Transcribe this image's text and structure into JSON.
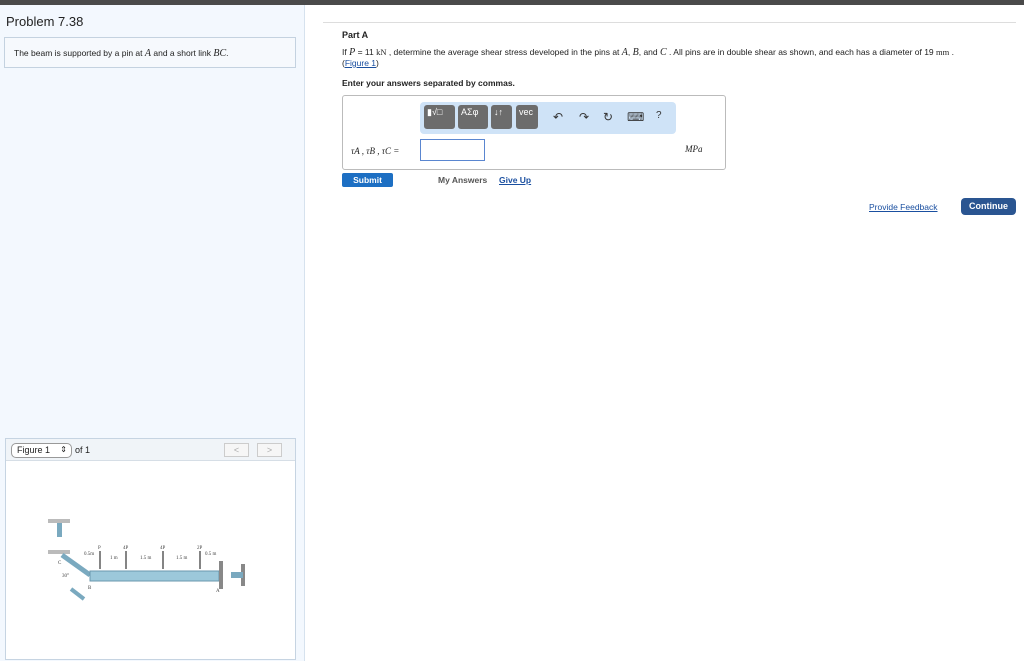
{
  "problem": {
    "title": "Problem 7.38",
    "intro_pre": "The beam is supported by a pin at ",
    "intro_A": "A",
    "intro_mid": " and a short link ",
    "intro_BC": "BC",
    "intro_end": "."
  },
  "figure": {
    "select_value": "Figure 1",
    "of_label": "of 1",
    "prev": "<",
    "next": ">",
    "labels": {
      "P": "P",
      "4P": "4P",
      "4P_2": "4P",
      "2P": "2P",
      "d1": "0.5m",
      "d2": "1 m",
      "d3": "1.5 m",
      "d4": "1.5 m",
      "d5": "0.5 m",
      "angle": "30°",
      "A": "A",
      "B": "B",
      "C": "C"
    }
  },
  "part": {
    "title": "Part A",
    "q1": "If ",
    "P": "P",
    "q2": " = 11 ",
    "kN": "kN",
    "q3": " , determine the average shear stress developed in the pins at ",
    "A": "A",
    "B": "B",
    "C": "C",
    "q4": " . All pins are in double shear as shown, and each has a diameter of 19 ",
    "mm": "mm",
    "q5": " .",
    "figure_link": "Figure 1",
    "instruction": "Enter your answers separated by commas.",
    "answer_label": "τA , τB , τC =",
    "answer_value": "",
    "unit": "MPa",
    "toolbar": {
      "templates": "▮√□",
      "greek": "ΑΣφ",
      "arrows": "↓↑",
      "vec": "vec",
      "undo": "↶",
      "redo": "↷",
      "reset": "↻",
      "keyboard": "⌨",
      "help": "?"
    },
    "submit": "Submit",
    "my_answers": "My Answers",
    "give_up": "Give Up"
  },
  "footer": {
    "feedback": "Provide Feedback",
    "continue": "Continue"
  },
  "colors": {
    "submit": "#1d6fc3",
    "continue": "#2a5591",
    "beam": "#9cc8da"
  }
}
